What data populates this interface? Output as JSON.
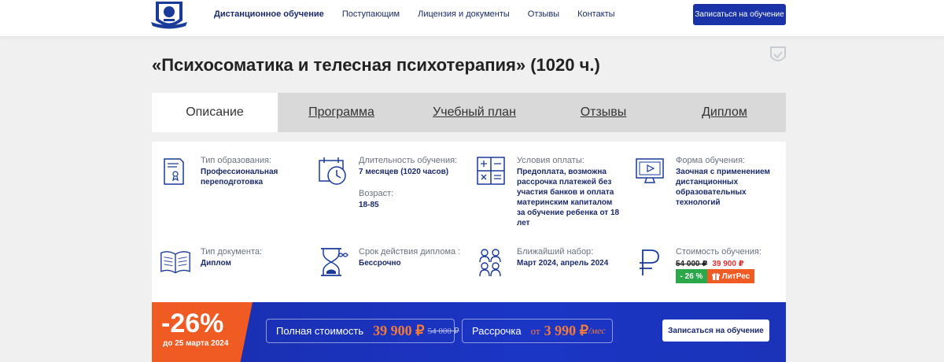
{
  "header": {
    "nav": [
      "Дистанционное обучение",
      "Поступающим",
      "Лицензия и документы",
      "Отзывы",
      "Контакты"
    ],
    "cta_label": "Записаться на обучение"
  },
  "page": {
    "title": "«Психосоматика и телесная психотерапия» (1020 ч.)"
  },
  "tabs": [
    "Описание",
    "Программа",
    "Учебный план",
    "Отзывы",
    "Диплом"
  ],
  "info": {
    "education_type": {
      "label": "Тип образования:",
      "value": "Профессиональная переподготовка"
    },
    "duration": {
      "label": "Длительность обучения:",
      "value": "7 месяцев (1020 часов)"
    },
    "age": {
      "label": "Возраст:",
      "value": "18-85"
    },
    "payment": {
      "label": "Условия оплаты:",
      "value": "Предоплата, возможна рассрочка платежей без участия банков и оплата материнским капиталом за обучение ребенка от 18 лет"
    },
    "form": {
      "label": "Форма обучения:",
      "value": "Заочная с применением дистанционных образовательных технологий"
    },
    "document": {
      "label": "Тип документа:",
      "value": "Диплом"
    },
    "validity": {
      "label": "Срок действия диплома :",
      "value": "Бессрочно"
    },
    "enrollment": {
      "label": "Ближайший набор:",
      "value": "Март 2024, апрель 2024"
    },
    "cost": {
      "label": "Стоимость обучения:",
      "old_price": "54 000 ₽",
      "new_price": "39 900 ₽",
      "discount_badge": "- 26 %",
      "gift_badge": "ЛитРес"
    }
  },
  "promo": {
    "discount": "-26%",
    "until": "до 25 марта 2024",
    "full_cost_label": "Полная стоимость",
    "full_cost_price": "39 900 ₽",
    "full_cost_old": "54 000 ₽",
    "installment_label": "Рассрочка",
    "installment_from": "от",
    "installment_price": "3 990 ₽",
    "installment_unit": "/мес",
    "cta_label": "Записаться на обучение"
  },
  "colors": {
    "brand_blue": "#1a33a8",
    "text_navy": "#1a2a6c",
    "accent_orange": "#f05a23",
    "price_red": "#e53030",
    "badge_green": "#2aa84a"
  }
}
